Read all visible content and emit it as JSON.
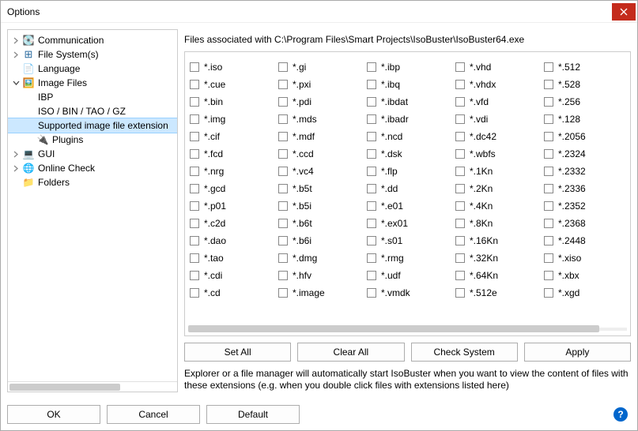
{
  "window": {
    "title": "Options"
  },
  "tree": [
    {
      "indent": 0,
      "expander": "closed",
      "icon": "disk",
      "label": "Communication",
      "sel": false
    },
    {
      "indent": 0,
      "expander": "closed",
      "icon": "filesys",
      "label": "File System(s)",
      "sel": false
    },
    {
      "indent": 0,
      "expander": "none",
      "icon": "lang",
      "label": "Language",
      "sel": false
    },
    {
      "indent": 0,
      "expander": "open",
      "icon": "img",
      "label": "Image Files",
      "sel": false
    },
    {
      "indent": 1,
      "expander": "none",
      "icon": "",
      "label": "IBP",
      "sel": false
    },
    {
      "indent": 1,
      "expander": "none",
      "icon": "",
      "label": "ISO / BIN / TAO / GZ",
      "sel": false
    },
    {
      "indent": 1,
      "expander": "none",
      "icon": "",
      "label": "Supported image file extension",
      "sel": true
    },
    {
      "indent": 1,
      "expander": "none",
      "icon": "plugins",
      "label": "Plugins",
      "sel": false
    },
    {
      "indent": 0,
      "expander": "closed",
      "icon": "gui",
      "label": "GUI",
      "sel": false
    },
    {
      "indent": 0,
      "expander": "closed",
      "icon": "online",
      "label": "Online Check",
      "sel": false
    },
    {
      "indent": 0,
      "expander": "none",
      "icon": "folder",
      "label": "Folders",
      "sel": false
    }
  ],
  "assoc_label": "Files associated with C:\\Program Files\\Smart Projects\\IsoBuster\\IsoBuster64.exe",
  "ext_columns": [
    [
      "*.iso",
      "*.cue",
      "*.bin",
      "*.img",
      "*.cif",
      "*.fcd",
      "*.nrg",
      "*.gcd",
      "*.p01",
      "*.c2d",
      "*.dao",
      "*.tao",
      "*.cdi",
      "*.cd"
    ],
    [
      "*.gi",
      "*.pxi",
      "*.pdi",
      "*.mds",
      "*.mdf",
      "*.ccd",
      "*.vc4",
      "*.b5t",
      "*.b5i",
      "*.b6t",
      "*.b6i",
      "*.dmg",
      "*.hfv",
      "*.image"
    ],
    [
      "*.ibp",
      "*.ibq",
      "*.ibdat",
      "*.ibadr",
      "*.ncd",
      "*.dsk",
      "*.flp",
      "*.dd",
      "*.e01",
      "*.ex01",
      "*.s01",
      "*.rmg",
      "*.udf",
      "*.vmdk"
    ],
    [
      "*.vhd",
      "*.vhdx",
      "*.vfd",
      "*.vdi",
      "*.dc42",
      "*.wbfs",
      "*.1Kn",
      "*.2Kn",
      "*.4Kn",
      "*.8Kn",
      "*.16Kn",
      "*.32Kn",
      "*.64Kn",
      "*.512e"
    ],
    [
      "*.512",
      "*.528",
      "*.256",
      "*.128",
      "*.2056",
      "*.2324",
      "*.2332",
      "*.2336",
      "*.2352",
      "*.2368",
      "*.2448",
      "*.xiso",
      "*.xbx",
      "*.xgd"
    ]
  ],
  "buttons": {
    "set_all": "Set All",
    "clear_all": "Clear All",
    "check_system": "Check System",
    "apply": "Apply"
  },
  "explain": "Explorer or a file manager will automatically start IsoBuster when you want to view the content of files with these extensions (e.g. when you double click files with extensions listed here)",
  "footer": {
    "ok": "OK",
    "cancel": "Cancel",
    "default": "Default"
  }
}
